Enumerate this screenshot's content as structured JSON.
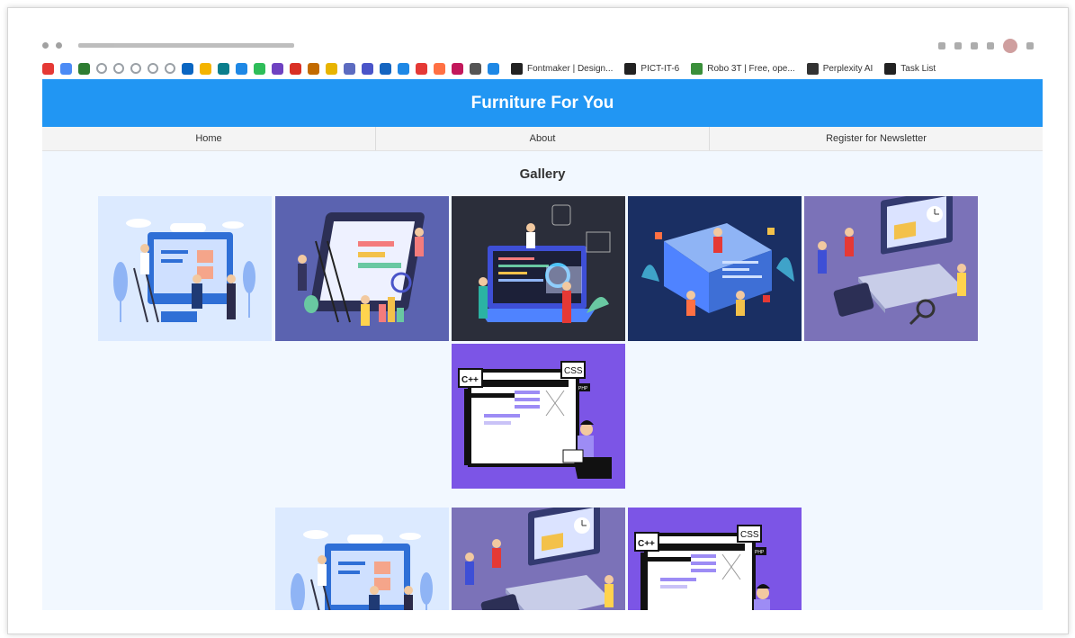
{
  "bookmarks": {
    "icon_colors": [
      "#e53935",
      "#4c8bf5",
      "#2e7d32",
      "#9aa0a6",
      "#9aa0a6",
      "#9aa0a6",
      "#9aa0a6",
      "#9aa0a6",
      "#0a66c2",
      "#f4b400",
      "#0a7e8c",
      "#1e88e5",
      "#2ebd59",
      "#6f42c1",
      "#d93025",
      "#c26a00",
      "#e8b400",
      "#5c6bc0",
      "#4a55c9",
      "#1565c0",
      "#1e88e5",
      "#e53935",
      "#ff7043",
      "#c2185b",
      "#555555",
      "#1e88e5"
    ],
    "links": [
      {
        "label": "Fontmaker | Design...",
        "icon": "fontmaker-icon",
        "color": "#222222"
      },
      {
        "label": "PICT-IT-6",
        "icon": "document-icon",
        "color": "#222222"
      },
      {
        "label": "Robo 3T | Free, ope...",
        "icon": "robo3t-icon",
        "color": "#3a8f3a"
      },
      {
        "label": "Perplexity AI",
        "icon": "perplexity-icon",
        "color": "#333333"
      },
      {
        "label": "Task List",
        "icon": "checkmark-icon",
        "color": "#222222"
      }
    ]
  },
  "site": {
    "title": "Furniture For You",
    "header_color": "#2196f3"
  },
  "nav": {
    "items": [
      "Home",
      "About",
      "Register for Newsletter"
    ]
  },
  "gallery": {
    "title": "Gallery",
    "images": [
      {
        "name": "web-design-team-illustration",
        "bg": "#dceaff"
      },
      {
        "name": "analytics-dashboard-illustration",
        "bg": "#5b63b0"
      },
      {
        "name": "laptop-coding-illustration",
        "bg": "#2b2e3a"
      },
      {
        "name": "isometric-web-illustration",
        "bg": "#1a2f63"
      },
      {
        "name": "laptop-developers-illustration",
        "bg": "#7b72b8"
      },
      {
        "name": "cpp-css-developer-illustration",
        "bg": "#7c55e6"
      },
      {
        "name": "web-design-team-illustration",
        "bg": "#dceaff"
      },
      {
        "name": "laptop-developers-illustration",
        "bg": "#7b72b8"
      },
      {
        "name": "cpp-css-developer-illustration",
        "bg": "#7c55e6"
      }
    ],
    "labels": {
      "cpp": "C++",
      "css": "CSS",
      "php": "PHP",
      "code": "</>"
    }
  }
}
